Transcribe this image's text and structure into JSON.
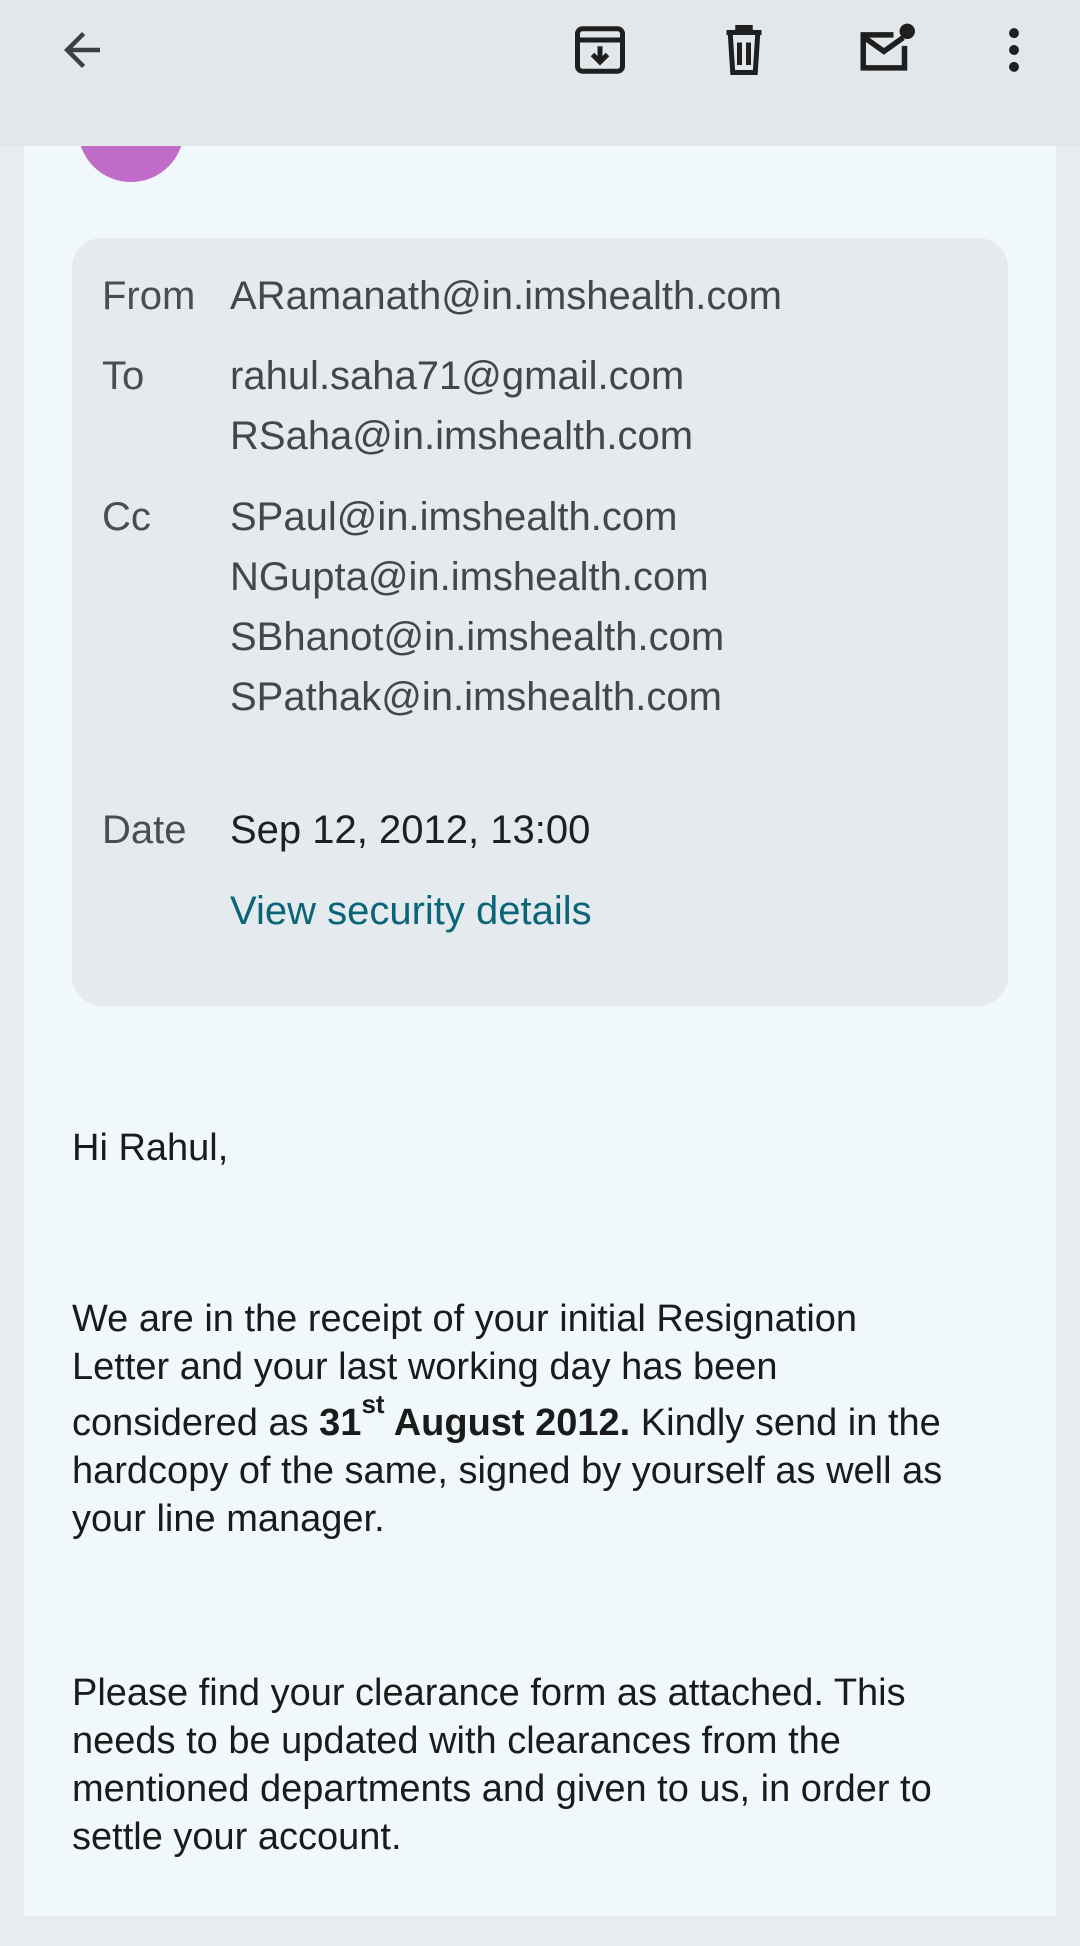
{
  "toolbar": {
    "back_icon": "arrow-back-icon",
    "archive_icon": "archive-icon",
    "delete_icon": "trash-icon",
    "unread_icon": "mark-unread-icon",
    "more_icon": "more-vert-icon"
  },
  "header": {
    "sender_snippet": "...  ,   ...  ,  ..."
  },
  "details": {
    "from_label": "From",
    "from": "ARamanath@in.imshealth.com",
    "to_label": "To",
    "to": [
      "rahul.saha71@gmail.com",
      "RSaha@in.imshealth.com"
    ],
    "cc_label": "Cc",
    "cc": [
      "SPaul@in.imshealth.com",
      "NGupta@in.imshealth.com",
      "SBhanot@in.imshealth.com",
      "SPathak@in.imshealth.com"
    ],
    "date_label": "Date",
    "date": "Sep 12, 2012, 13:00",
    "security_link": "View security details"
  },
  "body": {
    "greeting": "Hi Rahul,",
    "p1_line1": "We are in the receipt of your initial Resignation",
    "p1_line2": "Letter and your last working day has been",
    "p1_line3_start": "considered as ",
    "p1_date_day": "31",
    "p1_date_suffix": "st",
    "p1_date_rest": " August 2012.",
    "p1_line3_end": " Kindly send in the",
    "p1_line4": "hardcopy of the same, signed by yourself as well as",
    "p1_line5": "your line manager.",
    "p2_line1": "Please find your clearance form as attached. This",
    "p2_line2": "needs to be updated with clearances from the",
    "p2_line3": "mentioned departments and given to us, in order to",
    "p2_line4": "settle your account."
  },
  "colors": {
    "appbar": "#e1e7ea",
    "card": "#f1f8fc",
    "details_panel": "#e4eaee",
    "avatar": "#c06cc8",
    "link": "#0b6579"
  }
}
